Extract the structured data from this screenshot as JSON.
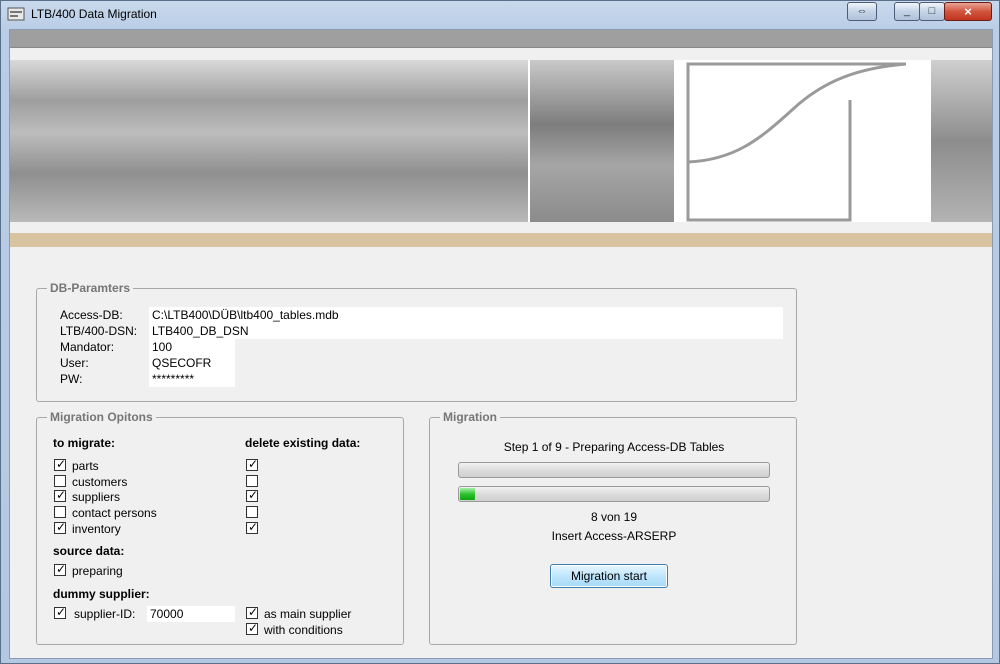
{
  "window": {
    "title": "LTB/400 Data Migration",
    "close_glyph": "×",
    "min_glyph": "_",
    "max_glyph": "□",
    "swap_glyph": "⇔"
  },
  "db_params": {
    "legend": "DB-Paramters",
    "access_db_label": "Access-DB:",
    "access_db_value": "C:\\LTB400\\DÜB\\ltb400_tables.mdb",
    "dsn_label": "LTB/400-DSN:",
    "dsn_value": "LTB400_DB_DSN",
    "mandator_label": "Mandator:",
    "mandator_value": "100",
    "user_label": "User:",
    "user_value": "QSECOFR",
    "pw_label": "PW:",
    "pw_value": "*********"
  },
  "options": {
    "legend": "Migration Opitons",
    "to_migrate_heading": "to migrate:",
    "delete_heading": "delete existing data:",
    "items": [
      {
        "label": "parts",
        "migrate": true,
        "delete": true
      },
      {
        "label": "customers",
        "migrate": false,
        "delete": false
      },
      {
        "label": "suppliers",
        "migrate": true,
        "delete": true
      },
      {
        "label": "contact persons",
        "migrate": false,
        "delete": false
      },
      {
        "label": "inventory",
        "migrate": true,
        "delete": true
      }
    ],
    "source_heading": "source data:",
    "preparing_label": "preparing",
    "preparing_checked": true,
    "dummy_heading": "dummy supplier:",
    "supplier_id_label": "supplier-ID:",
    "supplier_id_checked": true,
    "supplier_id_value": "70000",
    "main_supplier_label": "as main supplier",
    "main_supplier_checked": true,
    "conditions_label": "with conditions",
    "conditions_checked": true
  },
  "migration": {
    "legend": "Migration",
    "step_text": "Step 1 of 9 - Preparing Access-DB Tables",
    "overall_progress": 0,
    "table_progress": 0.05,
    "count_text": "8 von 19",
    "current_text": "Insert Access-ARSERP",
    "start_button": "Migration start"
  },
  "check_glyph": "✓"
}
